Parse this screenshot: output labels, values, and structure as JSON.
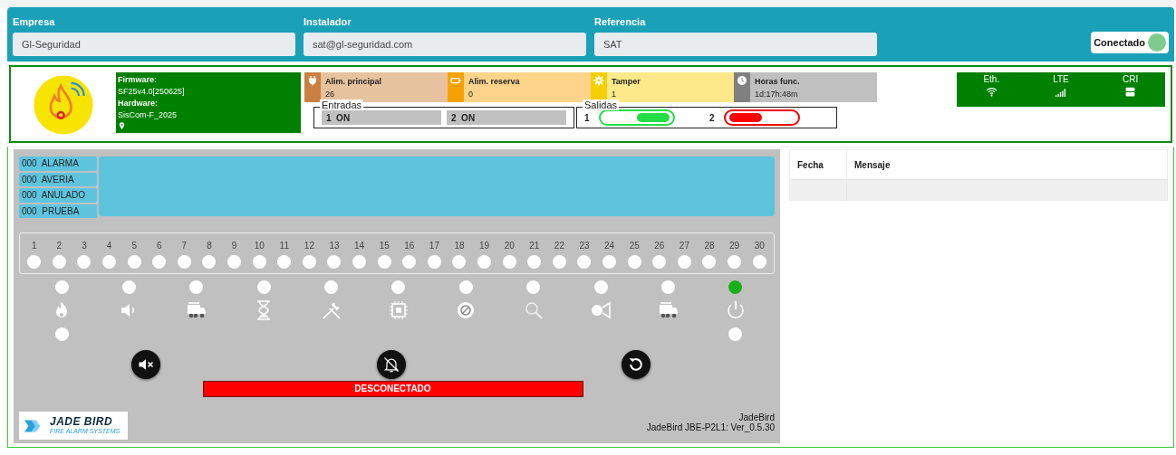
{
  "header": {
    "fields": [
      {
        "label": "Empresa",
        "value": "Gl-Seguridad"
      },
      {
        "label": "Instalador",
        "value": "sat@gl-seguridad.com"
      },
      {
        "label": "Referencia",
        "value": "SAT"
      }
    ],
    "connection": {
      "label": "Conectado",
      "on": true
    }
  },
  "device": {
    "firmware_label": "Firmware:",
    "firmware": "SF25v4.0[250625]",
    "hardware_label": "Hardware:",
    "hardware": "SisCom-F_2025"
  },
  "status_tiles": [
    {
      "kind": "power",
      "label": "Alim. principal",
      "value": "26"
    },
    {
      "kind": "battery",
      "label": "Alim. reserva",
      "value": "0"
    },
    {
      "kind": "tamper",
      "label": "Tamper",
      "value": "1"
    },
    {
      "kind": "clock",
      "label": "Horas func.",
      "value": "1d:17h:48m"
    }
  ],
  "entradas": {
    "title": "Entradas",
    "items": [
      {
        "number": "1",
        "state": "ON"
      },
      {
        "number": "2",
        "state": "ON"
      }
    ]
  },
  "salidas": {
    "title": "Salidas",
    "items": [
      {
        "number": "1",
        "on": true
      },
      {
        "number": "2",
        "on": false
      }
    ]
  },
  "comms": [
    {
      "kind": "wifi",
      "label": "Eth."
    },
    {
      "kind": "signal",
      "label": "LTE"
    },
    {
      "kind": "server",
      "label": "CRI"
    }
  ],
  "panel": {
    "counters": [
      {
        "count": "000",
        "label": "ALARMA"
      },
      {
        "count": "000",
        "label": "AVERIA"
      },
      {
        "count": "000",
        "label": "ANULADO"
      },
      {
        "count": "000",
        "label": "PRUEBA"
      }
    ],
    "zones": [
      "1",
      "2",
      "3",
      "4",
      "5",
      "6",
      "7",
      "8",
      "9",
      "10",
      "11",
      "12",
      "13",
      "14",
      "15",
      "16",
      "17",
      "18",
      "19",
      "20",
      "21",
      "22",
      "23",
      "24",
      "25",
      "26",
      "27",
      "28",
      "29",
      "30"
    ],
    "indicators": [
      {
        "kind": "fire",
        "lit": false,
        "second_led": true
      },
      {
        "kind": "speaker",
        "lit": false,
        "second_led": false
      },
      {
        "kind": "truck",
        "lit": false,
        "second_led": false
      },
      {
        "kind": "hourglass",
        "lit": false,
        "second_led": false
      },
      {
        "kind": "tools",
        "lit": false,
        "second_led": false
      },
      {
        "kind": "chip",
        "lit": false,
        "second_led": false
      },
      {
        "kind": "disable",
        "lit": false,
        "second_led": false
      },
      {
        "kind": "search",
        "lit": false,
        "second_led": false
      },
      {
        "kind": "horn",
        "lit": false,
        "second_led": false
      },
      {
        "kind": "truck",
        "lit": false,
        "second_led": false
      },
      {
        "kind": "power",
        "lit": true,
        "second_led": true
      }
    ],
    "buttons": [
      {
        "kind": "mute"
      },
      {
        "kind": "silence"
      },
      {
        "kind": "reset"
      }
    ],
    "status_banner": "DESCONECTADO",
    "brand": {
      "name": "JADE BIRD",
      "tagline": "FIRE ALARM SYSTEMS"
    },
    "footer": [
      "JadeBird",
      "JadeBird JBE-P2L1: Ver_0.5.30"
    ]
  },
  "log": {
    "columns": [
      "Fecha",
      "Mensaje"
    ]
  }
}
